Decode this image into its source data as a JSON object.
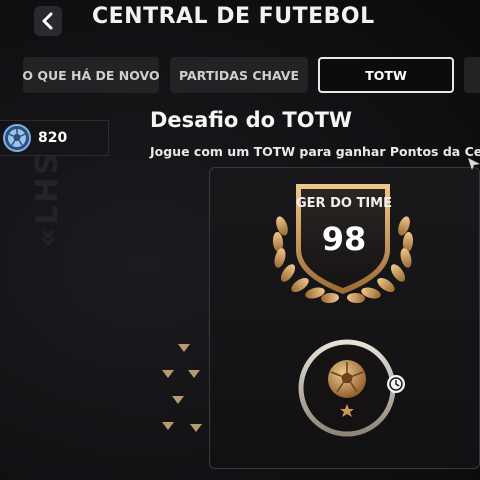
{
  "header": {
    "title": "CENTRAL DE FUTEBOL",
    "back_icon": "chevron-left-icon"
  },
  "tabs": [
    {
      "label": "O QUE HÁ DE NOVO",
      "active": false
    },
    {
      "label": "PARTIDAS CHAVE",
      "active": false
    },
    {
      "label": "TOTW",
      "active": true
    }
  ],
  "currency": {
    "icon": "football-coin-icon",
    "value": "820"
  },
  "challenge": {
    "title": "Desafio do TOTW",
    "description": "Jogue com um TOTW para ganhar Pontos da Cen",
    "badge_label": "GER DO TIME",
    "badge_value": "98",
    "reward_icon": "ball-icon",
    "timer_icon": "clock-icon"
  },
  "colors": {
    "gold": "#c9995a",
    "accent_blue": "#7fb0e8",
    "background": "#121114"
  }
}
